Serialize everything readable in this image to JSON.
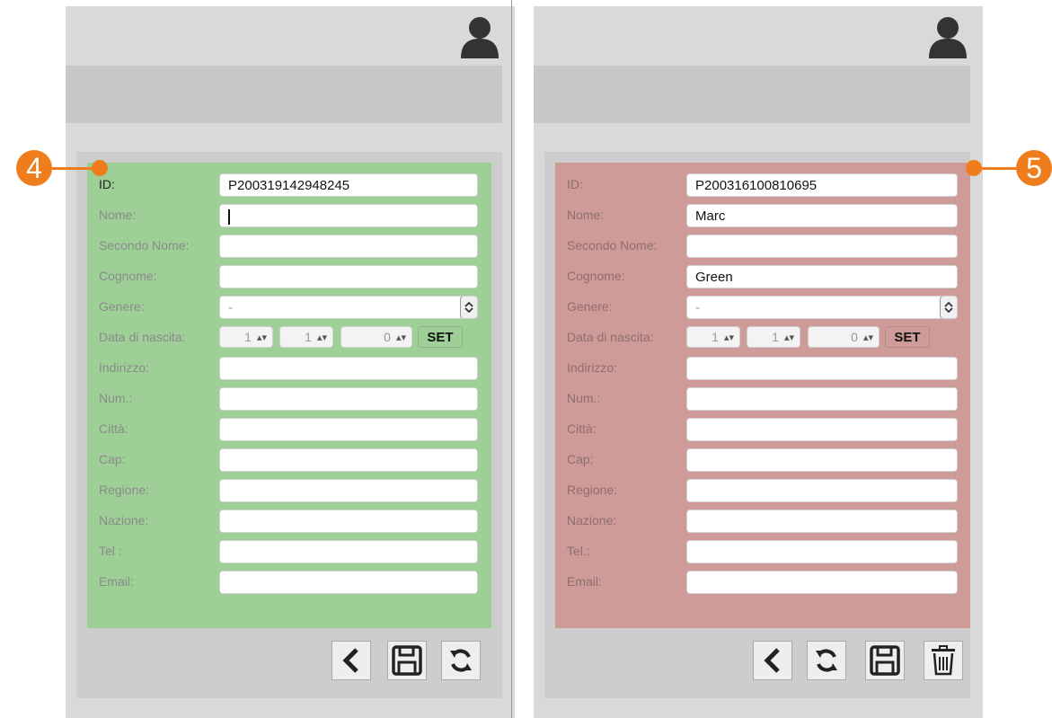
{
  "colors": {
    "accent": "#f07d1b",
    "form_new": "#9ecf97",
    "form_edit": "#cf9b99",
    "panel_bg": "#d9d9d9"
  },
  "annotations": {
    "left": "4",
    "right": "5"
  },
  "left_panel": {
    "fields": {
      "id": {
        "label": "ID:",
        "value": "P200319142948245"
      },
      "nome": {
        "label": "Nome:",
        "value": ""
      },
      "secondo_nome": {
        "label": "Secondo Nome:",
        "value": ""
      },
      "cognome": {
        "label": "Cognome:",
        "value": ""
      },
      "genere": {
        "label": "Genere:",
        "value": "-"
      },
      "data_di_nascita": {
        "label": "Data di nascita:",
        "day": "1",
        "month": "1",
        "year": "0",
        "set_label": "SET"
      },
      "indirizzo": {
        "label": "Indirizzo:",
        "value": ""
      },
      "num": {
        "label": "Num.:",
        "value": ""
      },
      "citta": {
        "label": "Città:",
        "value": ""
      },
      "cap": {
        "label": "Cap:",
        "value": ""
      },
      "regione": {
        "label": "Regione:",
        "value": ""
      },
      "nazione": {
        "label": "Nazione:",
        "value": ""
      },
      "tel": {
        "label": "Tel :",
        "value": ""
      },
      "email": {
        "label": "Email:",
        "value": ""
      }
    },
    "toolbar": [
      "back-icon",
      "save-icon",
      "refresh-icon"
    ]
  },
  "right_panel": {
    "fields": {
      "id": {
        "label": "ID:",
        "value": "P200316100810695"
      },
      "nome": {
        "label": "Nome:",
        "value": "Marc"
      },
      "secondo_nome": {
        "label": "Secondo Nome:",
        "value": ""
      },
      "cognome": {
        "label": "Cognome:",
        "value": "Green"
      },
      "genere": {
        "label": "Genere:",
        "value": "-"
      },
      "data_di_nascita": {
        "label": "Data di nascita:",
        "day": "1",
        "month": "1",
        "year": "0",
        "set_label": "SET"
      },
      "indirizzo": {
        "label": "Indirizzo:",
        "value": ""
      },
      "num": {
        "label": "Num.:",
        "value": ""
      },
      "citta": {
        "label": "Città:",
        "value": ""
      },
      "cap": {
        "label": "Cap:",
        "value": ""
      },
      "regione": {
        "label": "Regione:",
        "value": ""
      },
      "nazione": {
        "label": "Nazione:",
        "value": ""
      },
      "tel": {
        "label": "Tel.:",
        "value": ""
      },
      "email": {
        "label": "Email:",
        "value": ""
      }
    },
    "toolbar": [
      "back-icon",
      "refresh-icon",
      "save-icon",
      "trash-icon"
    ]
  }
}
